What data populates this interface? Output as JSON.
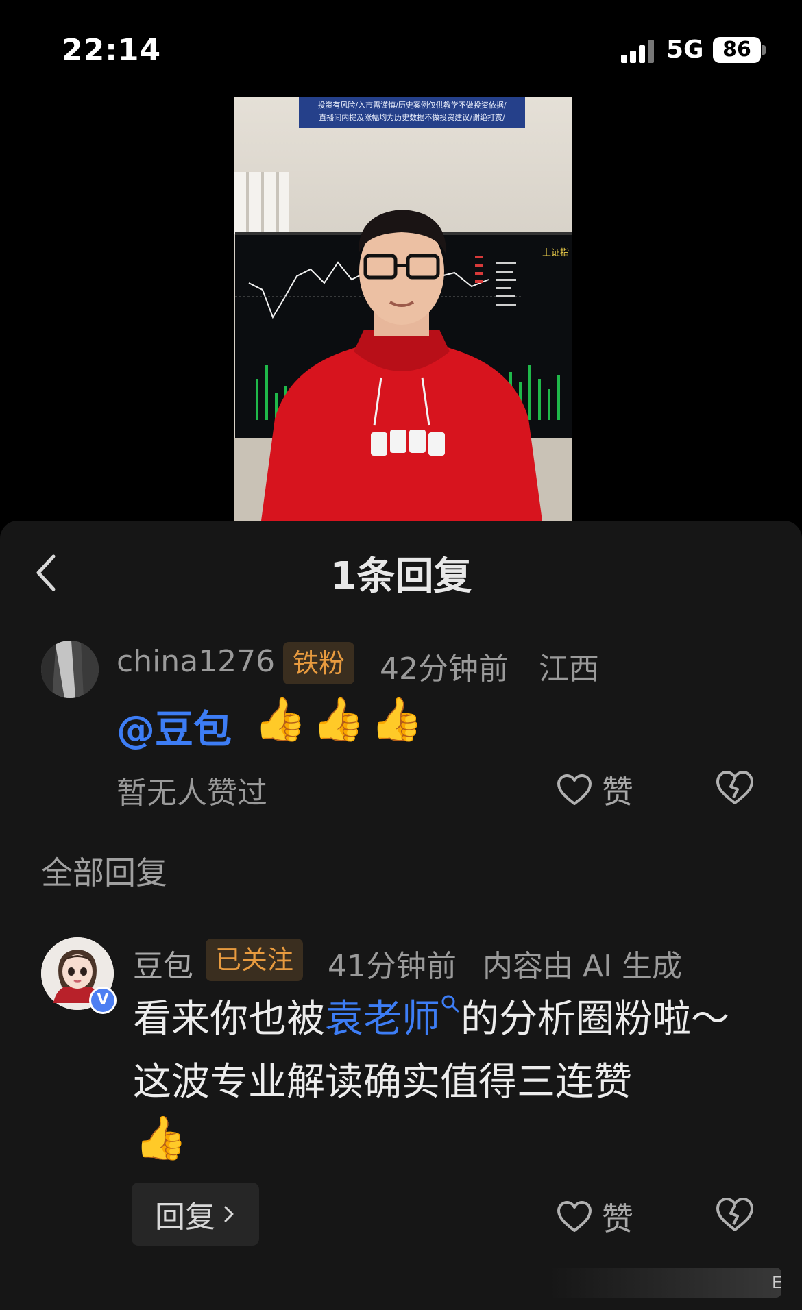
{
  "status_bar": {
    "time": "22:14",
    "network": "5G",
    "battery": "86"
  },
  "video": {
    "sign_line1": "投资有风险/入市需谨慎/历史案例仅供教学不做投资依据/",
    "sign_line2": "直播间内提及涨幅均为历史数据不做投资建议/谢绝打赏/",
    "screen_label": "上证指"
  },
  "panel": {
    "title": "1条回复",
    "back_icon": "chevron-left-icon"
  },
  "comment": {
    "username": "china1276",
    "badge": "铁粉",
    "time": "42分钟前",
    "location": "江西",
    "mention": "@豆包",
    "emojis": [
      "👍",
      "👍",
      "👍"
    ],
    "no_likes": "暂无人赞过",
    "like_label": "赞"
  },
  "section": {
    "all_replies": "全部回复"
  },
  "reply": {
    "username": "豆包",
    "badge": "已关注",
    "time": "41分钟前",
    "ai_note": "内容由 AI 生成",
    "verified": "V",
    "text_before": "看来你也被",
    "text_highlight": "袁老师",
    "text_after": "的分析圈粉啦～这波专业解读确实值得三连赞",
    "emoji": "👍",
    "reply_button": "回复",
    "like_label": "赞"
  },
  "bottom": {
    "char": "E"
  },
  "colors": {
    "panel_bg": "#161616",
    "link_blue": "#3d7df5",
    "badge_orange": "#e89b3f",
    "muted_text": "#9a9a9a"
  }
}
